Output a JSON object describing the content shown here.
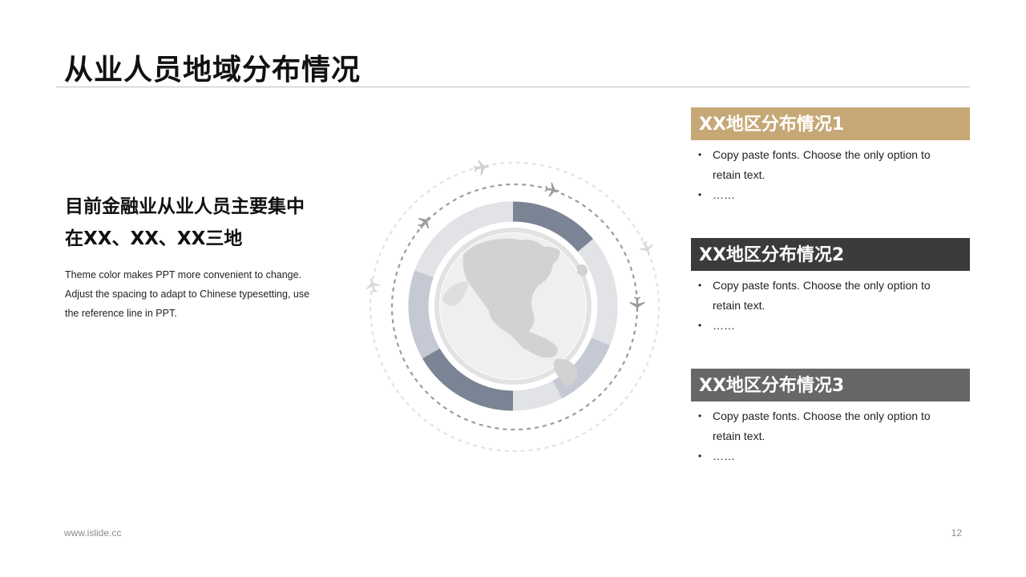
{
  "slide": {
    "title": "从业人员地域分布情况",
    "subtitle_lines": [
      "目前金融业从业人员主要集中",
      "在XX、XX、XX三地"
    ],
    "description_lines": [
      "Theme color makes PPT more convenient  to change.",
      "Adjust the spacing to adapt to Chinese  typesetting, use",
      "the reference line in PPT."
    ]
  },
  "graphic": {
    "ring_segment_colors": [
      "#7b8494",
      "#c4c9d3",
      "#e1e3e6"
    ],
    "globe_icon": "globe-americas-icon",
    "plane_icon": "airplane-icon"
  },
  "panels": [
    {
      "heading": "XX地区分布情况1",
      "color": "#c6a876",
      "bullets": [
        "Copy paste fonts. Choose the only option to",
        "retain text.",
        "……"
      ]
    },
    {
      "heading": "XX地区分布情况2",
      "color": "#3b3b3b",
      "bullets": [
        "Copy paste fonts. Choose the only option to",
        "retain text.",
        "……"
      ]
    },
    {
      "heading": "XX地区分布情况3",
      "color": "#676767",
      "bullets": [
        "Copy paste fonts. Choose the only option to",
        "retain text.",
        "……"
      ]
    }
  ],
  "footer": {
    "website": "www.islide.cc",
    "page_number": "12"
  }
}
